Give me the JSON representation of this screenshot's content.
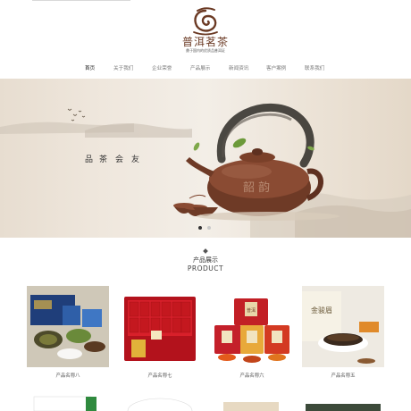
{
  "brand": {
    "name": "普洱茗茶",
    "slogan": "鼎于国内的优质品普洱证"
  },
  "nav": {
    "items": [
      {
        "label": "首页",
        "active": true
      },
      {
        "label": "关于我们",
        "active": false
      },
      {
        "label": "企业荣誉",
        "active": false
      },
      {
        "label": "产品展示",
        "active": false
      },
      {
        "label": "新闻资讯",
        "active": false
      },
      {
        "label": "客户案例",
        "active": false
      },
      {
        "label": "联系我们",
        "active": false
      }
    ]
  },
  "banner": {
    "tagline": [
      "品",
      "茶",
      "会",
      "友"
    ],
    "pot_text": "韶 韵",
    "slides": 2,
    "active_slide": 1
  },
  "products_section": {
    "title_cn": "产品展示",
    "title_en": "PRODUCT"
  },
  "products": [
    {
      "name": "产品名称八"
    },
    {
      "name": "产品名称七"
    },
    {
      "name": "产品名称六"
    },
    {
      "name": "产品名称五"
    }
  ],
  "product_images": {
    "card3_can_text": "普洱",
    "card4_box_text": "金骏眉"
  },
  "colors": {
    "brand_brown": "#6b3a24",
    "nav_text": "#777777",
    "nav_active": "#222222",
    "banner_bg": "#efe7dd"
  }
}
